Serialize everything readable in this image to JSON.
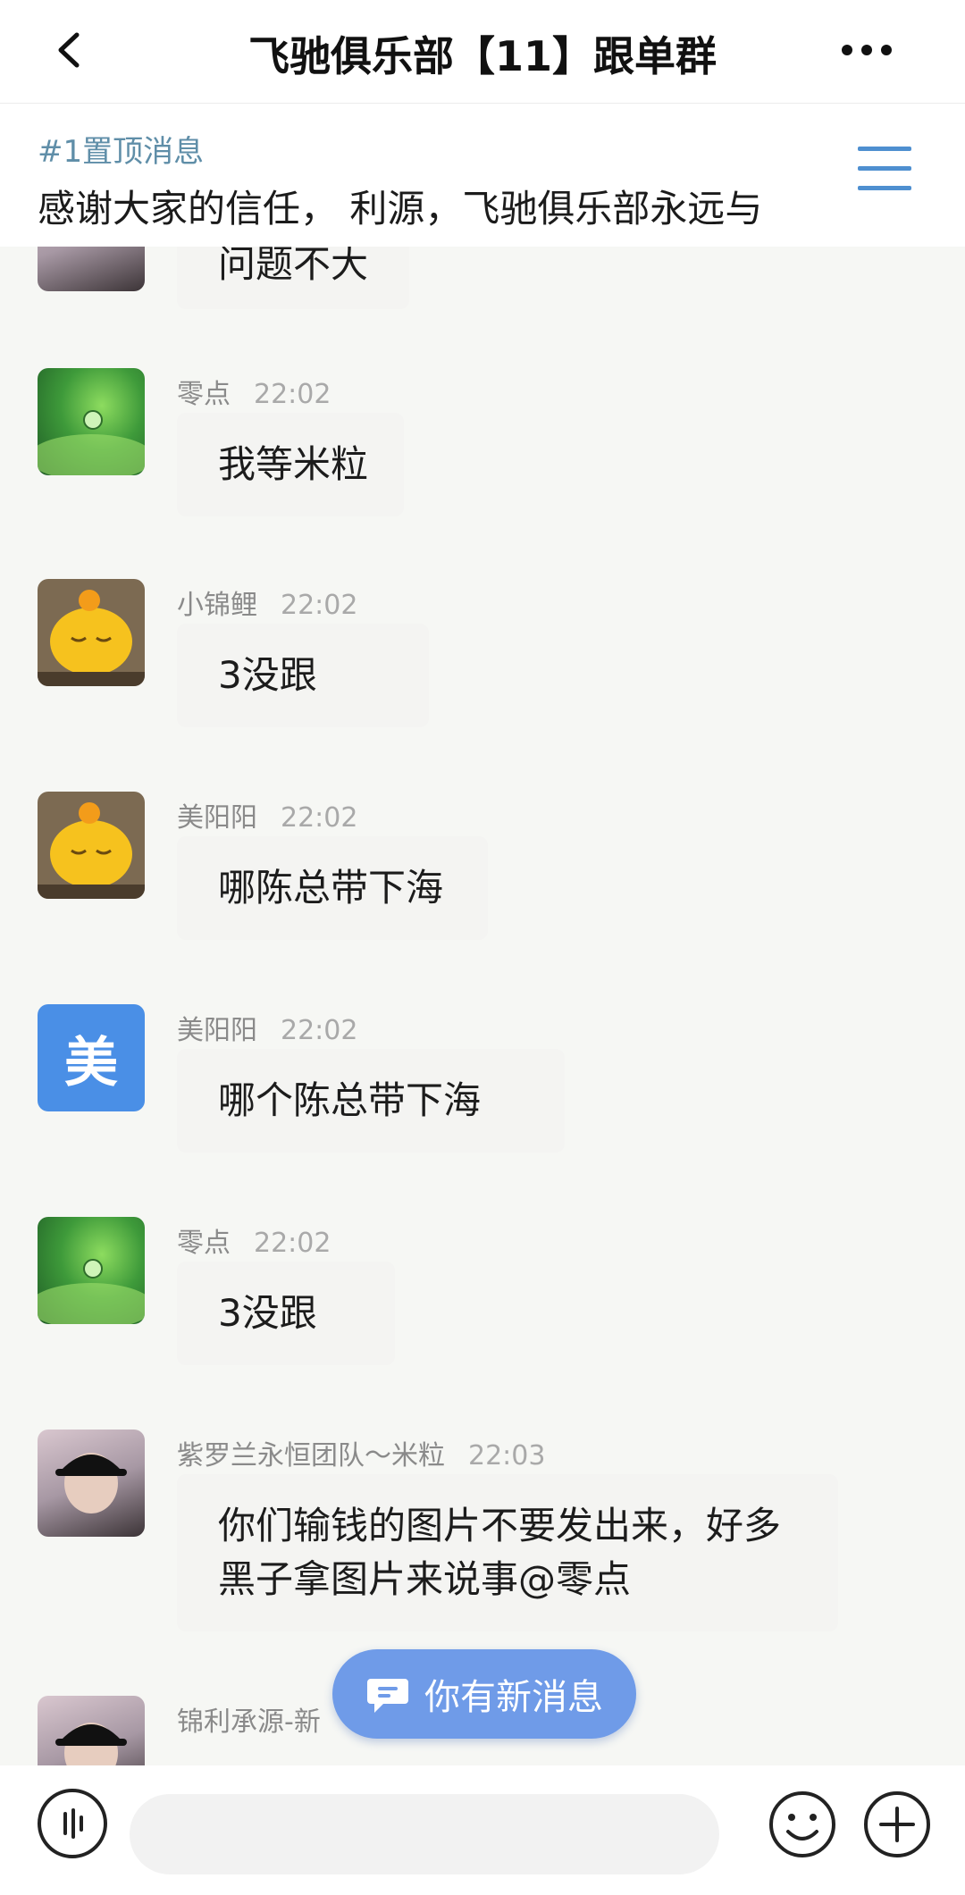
{
  "header": {
    "title": "飞驰俱乐部【11】跟单群",
    "back_icon": "chevron-left-icon",
    "more_icon": "more-dots-icon"
  },
  "pinned": {
    "label": "#1置顶消息",
    "text": "感谢大家的信任， 利源，飞驰俱乐部永远与",
    "menu_icon": "menu-lines-icon"
  },
  "messages": [
    {
      "sender": "",
      "time": "",
      "text": "问题不大",
      "avatar": "girl-photo"
    },
    {
      "sender": "零点",
      "time": "22:02",
      "text": "我等米粒",
      "avatar": "leaf-drop"
    },
    {
      "sender": "小锦鲤",
      "time": "22:02",
      "text": "3没跟",
      "avatar": "yellow-chick"
    },
    {
      "sender": "美阳阳",
      "time": "22:02",
      "text": "哪陈总带下海",
      "avatar": "yellow-chick"
    },
    {
      "sender": "美阳阳",
      "time": "22:02",
      "text": "哪个陈总带下海",
      "avatar": "美"
    },
    {
      "sender": "零点",
      "time": "22:02",
      "text": "3没跟",
      "avatar": "leaf-drop"
    },
    {
      "sender": "紫罗兰永恒团队～米粒",
      "time": "22:03",
      "text_line1": "你们输钱的图片不要发出来，好多",
      "text_line2": "黑子拿图片来说事@零点",
      "avatar": "girl-cap-photo"
    },
    {
      "sender": "锦利承源-新",
      "time": "",
      "text": "",
      "avatar": "girl-cap-photo"
    }
  ],
  "new_message_button": {
    "label": "你有新消息",
    "icon": "chat-bubble-icon"
  },
  "bottom_bar": {
    "voice_icon": "voice-icon",
    "input_placeholder": "",
    "emoji_icon": "smiley-icon",
    "plus_icon": "plus-circle-icon"
  },
  "colors": {
    "accent_blue": "#4a8fe6",
    "pill_blue": "#6f9be8",
    "pinned_label": "#5f8ea8",
    "chat_bg": "#f6f7f4"
  }
}
